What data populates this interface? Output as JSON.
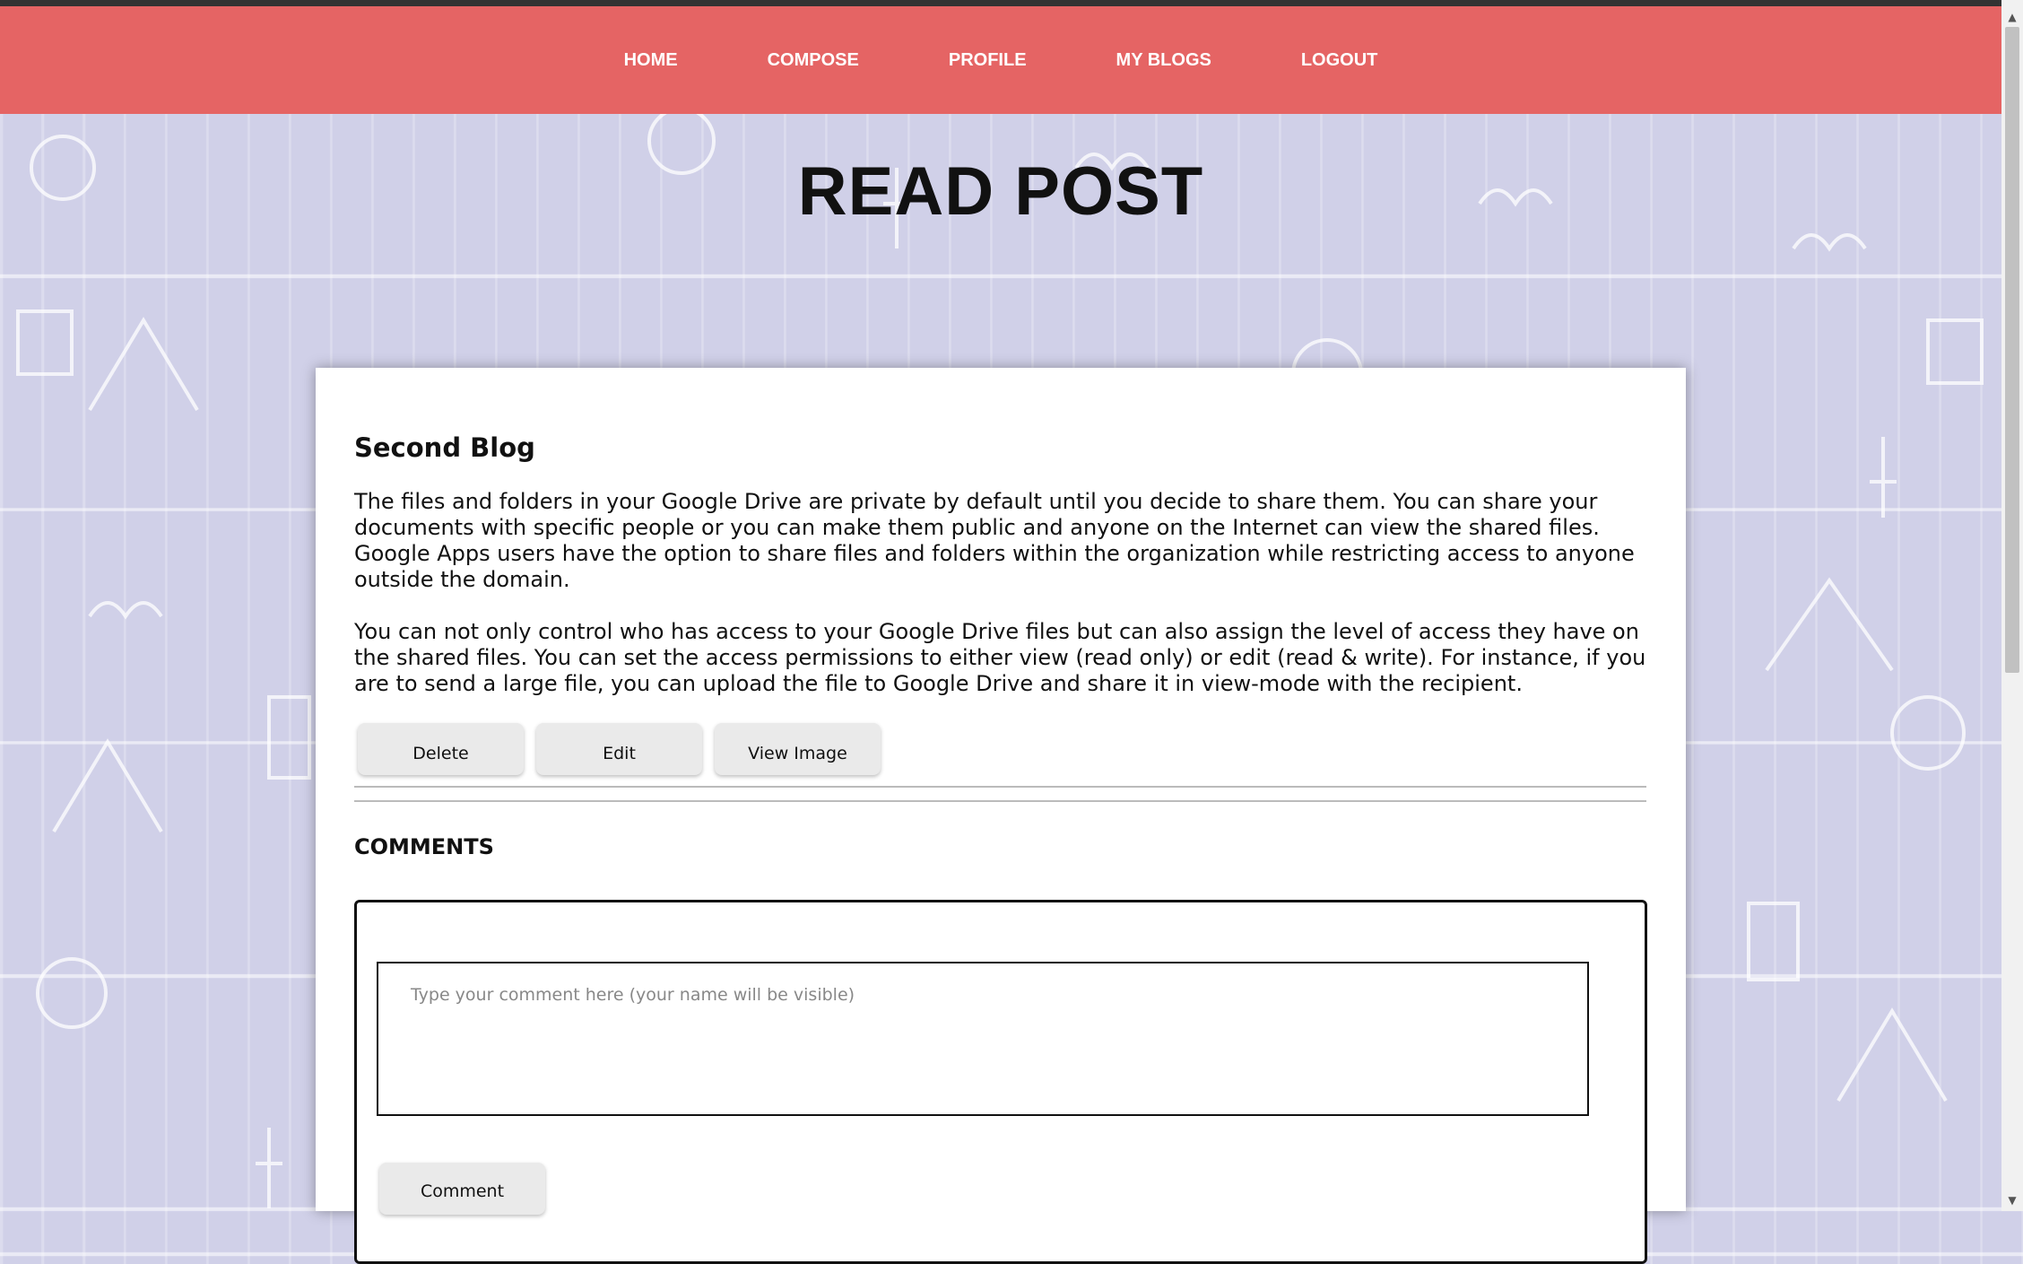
{
  "nav": {
    "items": [
      {
        "label": "HOME"
      },
      {
        "label": "COMPOSE"
      },
      {
        "label": "PROFILE"
      },
      {
        "label": "MY BLOGS"
      },
      {
        "label": "LOGOUT"
      }
    ]
  },
  "page": {
    "title": "READ POST"
  },
  "post": {
    "title": "Second Blog",
    "paragraphs": [
      "The files and folders in your Google Drive are private by default until you decide to share them. You can share your documents with specific people or you can make them public and anyone on the Internet can view the shared files. Google Apps users have the option to share files and folders within the organization while restricting access to anyone outside the domain.",
      "You can not only control who has access to your Google Drive files but can also assign the level of access they have on the shared files. You can set the access permissions to either view (read only) or edit (read & write). For instance, if you are to send a large file, you can upload the file to Google Drive and share it in view-mode with the recipient."
    ],
    "buttons": {
      "delete": "Delete",
      "edit": "Edit",
      "view_image": "View Image"
    }
  },
  "comments": {
    "heading": "COMMENTS",
    "input": {
      "value": "",
      "placeholder": "Type your comment here (your name will be visible)"
    },
    "submit_label": "Comment"
  },
  "colors": {
    "navbar": "#e56464",
    "background": "#d0d0e8",
    "card": "#ffffff",
    "button": "#eaeaea"
  },
  "icons": {
    "scroll_up": "arrow-up-icon",
    "scroll_down": "arrow-down-icon"
  }
}
